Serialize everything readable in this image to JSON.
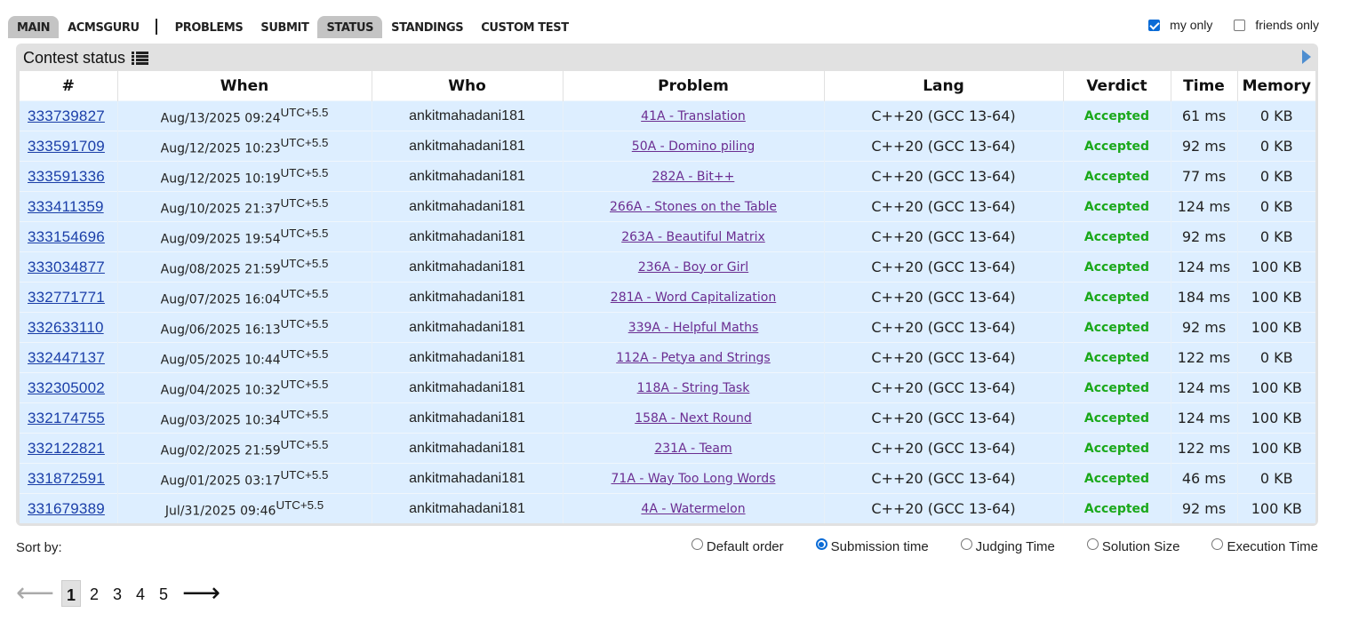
{
  "nav": {
    "items": [
      {
        "label": "MAIN",
        "active": true
      },
      {
        "label": "ACMSGURU",
        "active": false
      },
      {
        "label": "PROBLEMS",
        "active": false
      },
      {
        "label": "SUBMIT",
        "active": false
      },
      {
        "label": "STATUS",
        "active": true
      },
      {
        "label": "STANDINGS",
        "active": false
      },
      {
        "label": "CUSTOM TEST",
        "active": false
      }
    ]
  },
  "filters": {
    "my_only_label": "my only",
    "my_only_checked": true,
    "friends_only_label": "friends only",
    "friends_only_checked": false
  },
  "panel": {
    "title": "Contest status"
  },
  "table": {
    "headers": [
      "#",
      "When",
      "Who",
      "Problem",
      "Lang",
      "Verdict",
      "Time",
      "Memory"
    ],
    "rows": [
      {
        "id": "333739827",
        "when": "Aug/13/2025 09:24",
        "tz": "UTC+5.5",
        "who": "ankitmahadani181",
        "problem": "41A - Translation",
        "lang": "C++20 (GCC 13-64)",
        "verdict": "Accepted",
        "time": "61 ms",
        "memory": "0 KB"
      },
      {
        "id": "333591709",
        "when": "Aug/12/2025 10:23",
        "tz": "UTC+5.5",
        "who": "ankitmahadani181",
        "problem": "50A - Domino piling",
        "lang": "C++20 (GCC 13-64)",
        "verdict": "Accepted",
        "time": "92 ms",
        "memory": "0 KB"
      },
      {
        "id": "333591336",
        "when": "Aug/12/2025 10:19",
        "tz": "UTC+5.5",
        "who": "ankitmahadani181",
        "problem": "282A - Bit++",
        "lang": "C++20 (GCC 13-64)",
        "verdict": "Accepted",
        "time": "77 ms",
        "memory": "0 KB"
      },
      {
        "id": "333411359",
        "when": "Aug/10/2025 21:37",
        "tz": "UTC+5.5",
        "who": "ankitmahadani181",
        "problem": "266A - Stones on the Table",
        "lang": "C++20 (GCC 13-64)",
        "verdict": "Accepted",
        "time": "124 ms",
        "memory": "0 KB"
      },
      {
        "id": "333154696",
        "when": "Aug/09/2025 19:54",
        "tz": "UTC+5.5",
        "who": "ankitmahadani181",
        "problem": "263A - Beautiful Matrix",
        "lang": "C++20 (GCC 13-64)",
        "verdict": "Accepted",
        "time": "92 ms",
        "memory": "0 KB"
      },
      {
        "id": "333034877",
        "when": "Aug/08/2025 21:59",
        "tz": "UTC+5.5",
        "who": "ankitmahadani181",
        "problem": "236A - Boy or Girl",
        "lang": "C++20 (GCC 13-64)",
        "verdict": "Accepted",
        "time": "124 ms",
        "memory": "100 KB"
      },
      {
        "id": "332771771",
        "when": "Aug/07/2025 16:04",
        "tz": "UTC+5.5",
        "who": "ankitmahadani181",
        "problem": "281A - Word Capitalization",
        "lang": "C++20 (GCC 13-64)",
        "verdict": "Accepted",
        "time": "184 ms",
        "memory": "100 KB"
      },
      {
        "id": "332633110",
        "when": "Aug/06/2025 16:13",
        "tz": "UTC+5.5",
        "who": "ankitmahadani181",
        "problem": "339A - Helpful Maths",
        "lang": "C++20 (GCC 13-64)",
        "verdict": "Accepted",
        "time": "92 ms",
        "memory": "100 KB"
      },
      {
        "id": "332447137",
        "when": "Aug/05/2025 10:44",
        "tz": "UTC+5.5",
        "who": "ankitmahadani181",
        "problem": "112A - Petya and Strings",
        "lang": "C++20 (GCC 13-64)",
        "verdict": "Accepted",
        "time": "122 ms",
        "memory": "0 KB"
      },
      {
        "id": "332305002",
        "when": "Aug/04/2025 10:32",
        "tz": "UTC+5.5",
        "who": "ankitmahadani181",
        "problem": "118A - String Task",
        "lang": "C++20 (GCC 13-64)",
        "verdict": "Accepted",
        "time": "124 ms",
        "memory": "100 KB"
      },
      {
        "id": "332174755",
        "when": "Aug/03/2025 10:34",
        "tz": "UTC+5.5",
        "who": "ankitmahadani181",
        "problem": "158A - Next Round",
        "lang": "C++20 (GCC 13-64)",
        "verdict": "Accepted",
        "time": "124 ms",
        "memory": "100 KB"
      },
      {
        "id": "332122821",
        "when": "Aug/02/2025 21:59",
        "tz": "UTC+5.5",
        "who": "ankitmahadani181",
        "problem": "231A - Team",
        "lang": "C++20 (GCC 13-64)",
        "verdict": "Accepted",
        "time": "122 ms",
        "memory": "100 KB"
      },
      {
        "id": "331872591",
        "when": "Aug/01/2025 03:17",
        "tz": "UTC+5.5",
        "who": "ankitmahadani181",
        "problem": "71A - Way Too Long Words",
        "lang": "C++20 (GCC 13-64)",
        "verdict": "Accepted",
        "time": "46 ms",
        "memory": "0 KB"
      },
      {
        "id": "331679389",
        "when": "Jul/31/2025 09:46",
        "tz": "UTC+5.5",
        "who": "ankitmahadani181",
        "problem": "4A - Watermelon",
        "lang": "C++20 (GCC 13-64)",
        "verdict": "Accepted",
        "time": "92 ms",
        "memory": "100 KB"
      }
    ]
  },
  "sort": {
    "label": "Sort by:",
    "options": [
      {
        "label": "Default order",
        "checked": false
      },
      {
        "label": "Submission time",
        "checked": true
      },
      {
        "label": "Judging Time",
        "checked": false
      },
      {
        "label": "Solution Size",
        "checked": false
      },
      {
        "label": "Execution Time",
        "checked": false
      }
    ]
  },
  "pagination": {
    "prev": "⟵",
    "next": "⟶",
    "pages": [
      "1",
      "2",
      "3",
      "4",
      "5"
    ],
    "current": "1"
  },
  "colors": {
    "accepted": "#1aa81a",
    "row_bg": "#ddeeff",
    "link": "#1a3ea8",
    "problem_link": "#6b2d91"
  },
  "icons": [
    "list-icon",
    "arrow-right-icon",
    "checkbox-icon"
  ]
}
